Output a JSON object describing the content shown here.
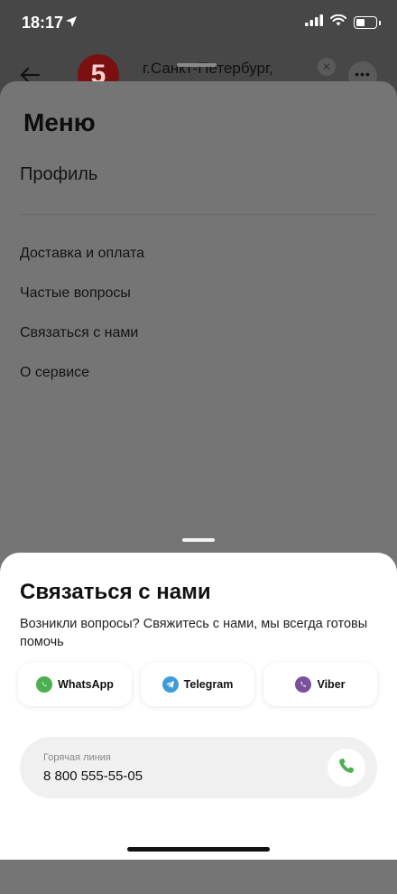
{
  "status_bar": {
    "time": "18:17"
  },
  "header": {
    "city": "г.Санкт-Петербург,",
    "logo_text": "5",
    "more": "•••"
  },
  "menu": {
    "title": "Меню",
    "profile": "Профиль",
    "items": [
      {
        "label": "Доставка и оплата"
      },
      {
        "label": "Частые вопросы"
      },
      {
        "label": "Связаться с нами"
      },
      {
        "label": "О сервисе"
      }
    ]
  },
  "contact": {
    "title": "Связаться с нами",
    "subtitle": "Возникли вопросы? Свяжитесь с нами, мы всегда готовы помочь",
    "messengers": [
      {
        "label": "WhatsApp",
        "icon": "whatsapp-icon",
        "color": "#4CAF50"
      },
      {
        "label": "Telegram",
        "icon": "telegram-icon",
        "color": "#3E9BDA"
      },
      {
        "label": "Viber",
        "icon": "viber-icon",
        "color": "#7B519D"
      }
    ],
    "hotline": {
      "label": "Горячая линия",
      "number": "8 800 555-55-05",
      "icon": "phone-icon",
      "color": "#4CAF50"
    }
  }
}
